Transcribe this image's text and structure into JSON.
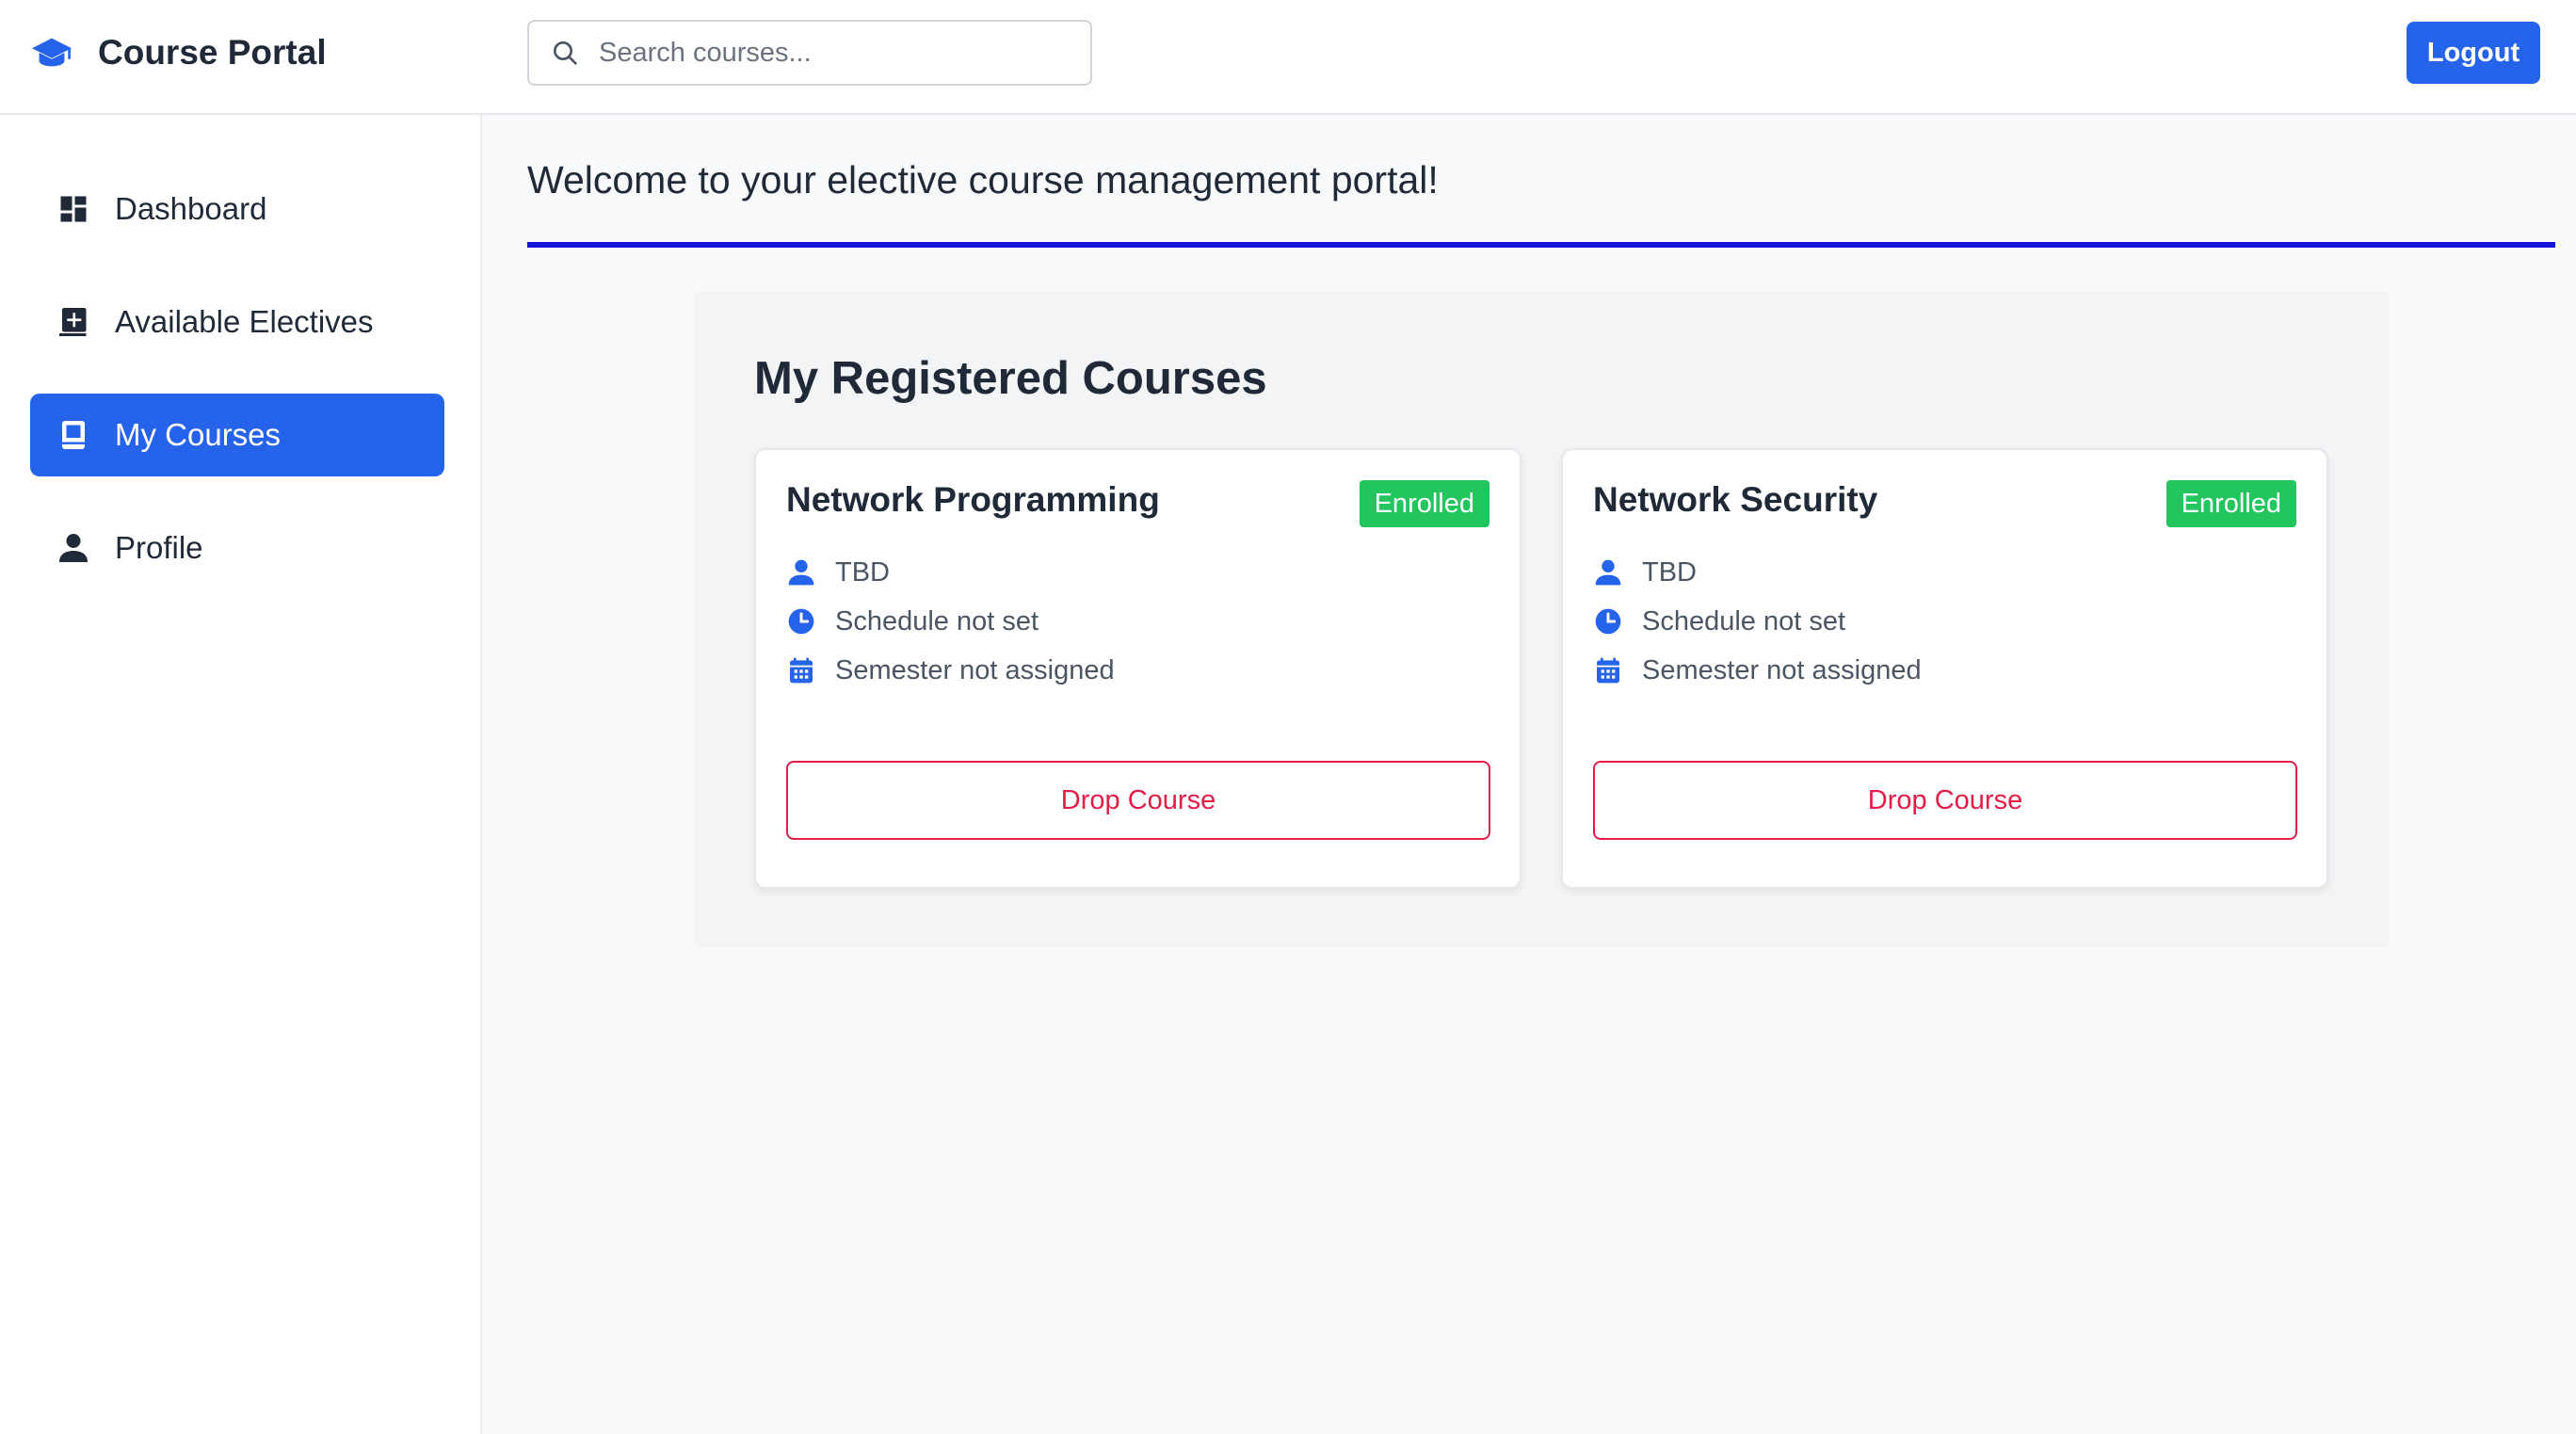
{
  "header": {
    "brand_icon": "graduation-cap-icon",
    "brand_title": "Course Portal",
    "search_placeholder": "Search courses...",
    "logout_label": "Logout"
  },
  "sidebar": {
    "items": [
      {
        "label": "Dashboard",
        "icon": "dashboard-icon",
        "active": false
      },
      {
        "label": "Available Electives",
        "icon": "add-book-icon",
        "active": false
      },
      {
        "label": "My Courses",
        "icon": "book-icon",
        "active": true
      },
      {
        "label": "Profile",
        "icon": "person-icon",
        "active": false
      }
    ]
  },
  "main": {
    "welcome": "Welcome to your elective course management portal!",
    "panel_title": "My Registered Courses",
    "courses": [
      {
        "title": "Network Programming",
        "status": "Enrolled",
        "instructor": "TBD",
        "schedule": "Schedule not set",
        "semester": "Semester not assigned",
        "drop_label": "Drop Course"
      },
      {
        "title": "Network Security",
        "status": "Enrolled",
        "instructor": "TBD",
        "schedule": "Schedule not set",
        "semester": "Semester not assigned",
        "drop_label": "Drop Course"
      }
    ]
  },
  "colors": {
    "accent": "#2563eb",
    "enrolled_badge": "#22c55e",
    "drop_button": "#e11d48",
    "divider": "#1414d8"
  }
}
